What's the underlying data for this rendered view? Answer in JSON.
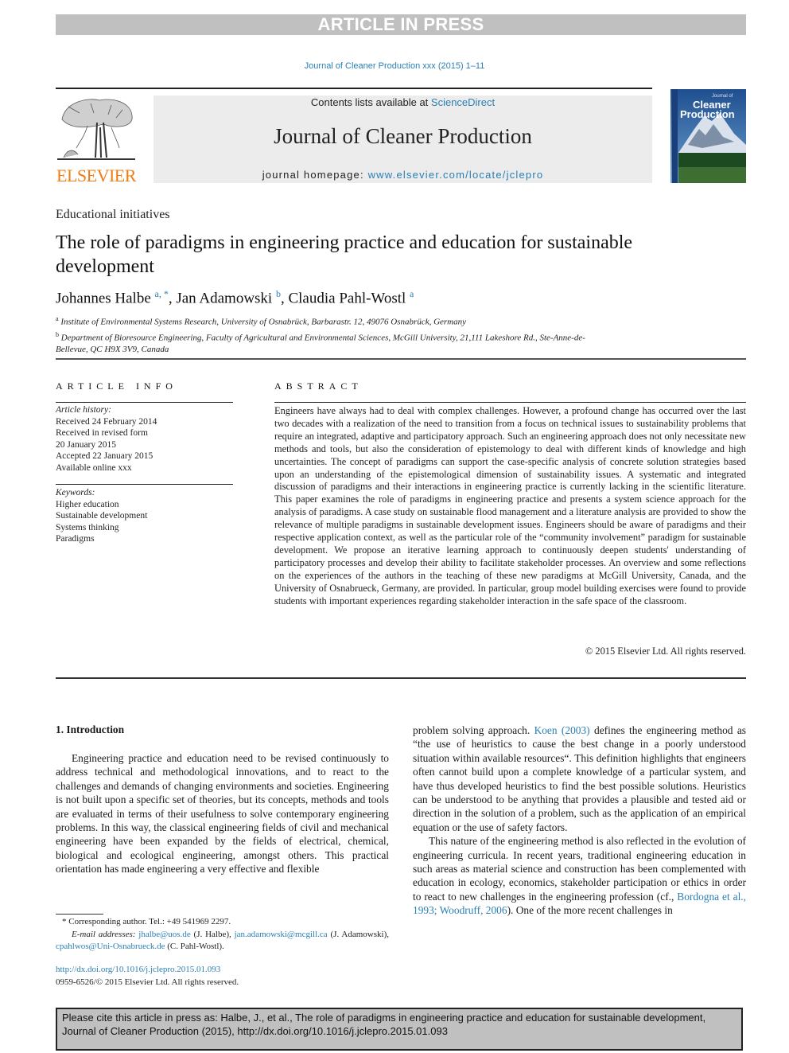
{
  "banner": {
    "text": "ARTICLE IN PRESS"
  },
  "running_head": "Journal of Cleaner Production xxx (2015) 1–11",
  "masthead": {
    "publisher_logo_text": "ELSEVIER",
    "contents_prefix": "Contents lists available at ",
    "contents_link": "ScienceDirect",
    "journal_title": "Journal of Cleaner Production",
    "homepage_prefix": "journal homepage: ",
    "homepage_link": "www.elsevier.com/locate/jclepro",
    "cover": {
      "small_title": "Journal of",
      "title_line1": "Cleaner",
      "title_line2": "Production"
    }
  },
  "article": {
    "section": "Educational initiatives",
    "title": "The role of paradigms in engineering practice and education for sustainable development",
    "authors": [
      {
        "name": "Johannes Halbe",
        "marks": "a, *"
      },
      {
        "name": "Jan Adamowski",
        "marks": "b"
      },
      {
        "name": "Claudia Pahl-Wostl",
        "marks": "a"
      }
    ],
    "affiliations": [
      {
        "mark": "a",
        "text": "Institute of Environmental Systems Research, University of Osnabrück, Barbarastr. 12, 49076 Osnabrück, Germany"
      },
      {
        "mark": "b",
        "text": "Department of Bioresource Engineering, Faculty of Agricultural and Environmental Sciences, McGill University, 21,111 Lakeshore Rd., Ste-Anne-de-Bellevue, QC H9X 3V9, Canada"
      }
    ]
  },
  "article_info": {
    "heading": "ARTICLE INFO",
    "history_label": "Article history:",
    "history": [
      "Received 24 February 2014",
      "Received in revised form",
      "20 January 2015",
      "Accepted 22 January 2015",
      "Available online xxx"
    ],
    "keywords_label": "Keywords:",
    "keywords": [
      "Higher education",
      "Sustainable development",
      "Systems thinking",
      "Paradigms"
    ]
  },
  "abstract": {
    "heading": "ABSTRACT",
    "text": "Engineers have always had to deal with complex challenges. However, a profound change has occurred over the last two decades with a realization of the need to transition from a focus on technical issues to sustainability problems that require an integrated, adaptive and participatory approach. Such an engineering approach does not only necessitate new methods and tools, but also the consideration of epistemology to deal with different kinds of knowledge and high uncertainties. The concept of paradigms can support the case-specific analysis of concrete solution strategies based upon an understanding of the epistemological dimension of sustainability issues. A systematic and integrated discussion of paradigms and their interactions in engineering practice is currently lacking in the scientific literature. This paper examines the role of paradigms in engineering practice and presents a system science approach for the analysis of paradigms. A case study on sustainable flood management and a literature analysis are provided to show the relevance of multiple paradigms in sustainable development issues. Engineers should be aware of paradigms and their respective application context, as well as the particular role of the “community involvement” paradigm for sustainable development. We propose an iterative learning approach to continuously deepen students' understanding of participatory processes and develop their ability to facilitate stakeholder processes. An overview and some reflections on the experiences of the authors in the teaching of these new paradigms at McGill University, Canada, and the University of Osnabrueck, Germany, are provided. In particular, group model building exercises were found to provide students with important experiences regarding stakeholder interaction in the safe space of the classroom.",
    "copyright": "© 2015 Elsevier Ltd. All rights reserved."
  },
  "body": {
    "section_heading": "1.  Introduction",
    "left_para": "Engineering practice and education need to be revised continuously to address technical and methodological innovations, and to react to the challenges and demands of changing environments and societies. Engineering is not built upon a specific set of theories, but its concepts, methods and tools are evaluated in terms of their usefulness to solve contemporary engineering problems. In this way, the classical engineering fields of civil and mechanical engineering have been expanded by the fields of electrical, chemical, biological and ecological engineering, amongst others. This practical orientation has made engineering a very effective and flexible",
    "right_para1_pre": "problem solving approach. ",
    "right_para1_cite": "Koen (2003)",
    "right_para1_post": " defines the engineering method as “the use of heuristics to cause the best change in a poorly understood situation within available resources“. This definition highlights that engineers often cannot build upon a complete knowledge of a particular system, and have thus developed heuristics to find the best possible solutions. Heuristics can be understood to be anything that provides a plausible and tested aid or direction in the solution of a problem, such as the application of an empirical equation or the use of safety factors.",
    "right_para2_pre": "This nature of the engineering method is also reflected in the evolution of engineering curricula. In recent years, traditional engineering education in such areas as material science and construction has been complemented with education in ecology, economics, stakeholder participation or ethics in order to react to new challenges in the engineering profession (cf., ",
    "right_para2_cite": "Bordogna et al., 1993; Woodruff, 2006",
    "right_para2_post": "). One of the more recent challenges in"
  },
  "footnotes": {
    "corresponding": "* Corresponding author. Tel.: +49 541969 2297.",
    "email_label": "E-mail addresses:",
    "emails": [
      {
        "address": "jhalbe@uos.de",
        "owner": "(J. Halbe),"
      },
      {
        "address": "jan.adamowski@mcgill.ca",
        "owner": "(J. Adamowski),"
      },
      {
        "address": "cpahlwos@Uni-Osnabrueck.de",
        "owner": "(C. Pahl-Wostl)."
      }
    ],
    "doi": "http://dx.doi.org/10.1016/j.jclepro.2015.01.093",
    "issn_copyright": "0959-6526/© 2015 Elsevier Ltd. All rights reserved."
  },
  "citation_box": {
    "line1": "Please cite this article in press as: Halbe, J., et al., The role of paradigms in engineering practice and education for sustainable development,",
    "line2": "Journal of Cleaner Production (2015), http://dx.doi.org/10.1016/j.jclepro.2015.01.093"
  },
  "colors": {
    "link": "#2a7fb4",
    "elsevier_orange": "#f07c12",
    "banner_gray": "#c0c0c0",
    "masthead_gray": "#ececec"
  }
}
